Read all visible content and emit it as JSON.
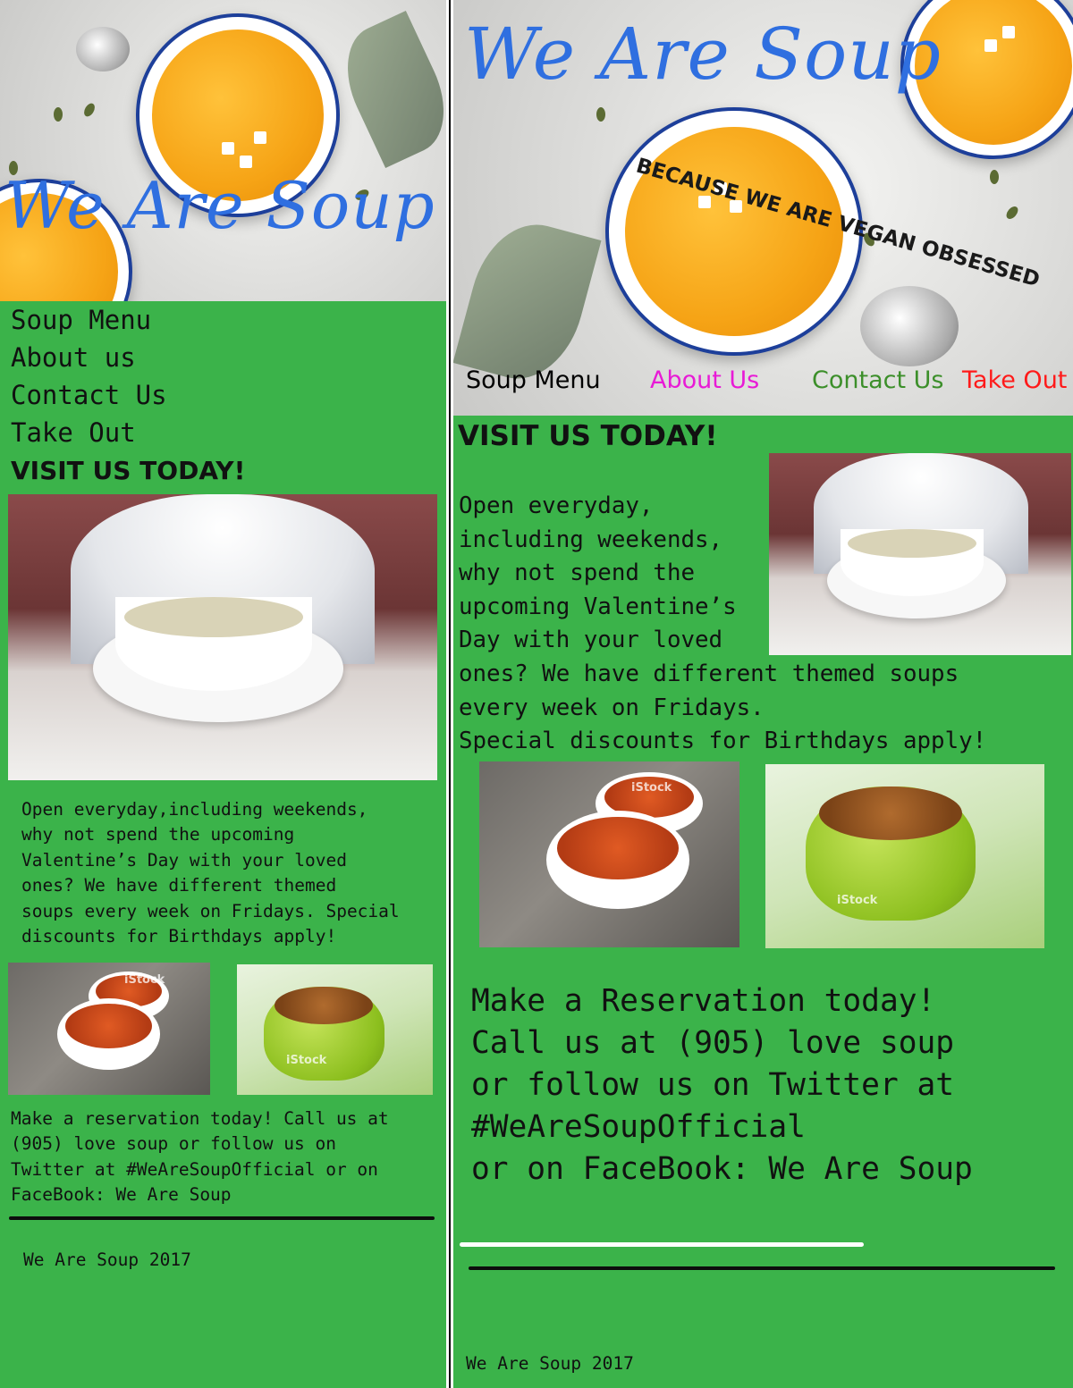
{
  "brand": {
    "name": "We Are Soup",
    "tagline": "Because we are vegan obsessed"
  },
  "nav": {
    "items": [
      "Soup Menu",
      "About us",
      "Contact Us",
      "Take Out"
    ],
    "items_wide": [
      "Soup Menu",
      "About Us",
      "Contact Us",
      "Take Out"
    ],
    "colors_wide": [
      "#000000",
      "#e81ad6",
      "#3c8f2a",
      "#ff1a1a"
    ]
  },
  "visit": {
    "heading": "Visit us today!",
    "body_mobile": "Open everyday,including weekends,\nwhy not spend the upcoming\nValentine’s Day with your loved\nones? We have different themed\nsoups every week on Fridays. Special\ndiscounts for Birthdays apply!",
    "body_wide": "Open everyday,\nincluding weekends,\nwhy not spend the\nupcoming Valentine’s\nDay with your loved\nones? We have different themed soups\nevery week on Fridays.\nSpecial discounts for Birthdays apply!"
  },
  "reservation": {
    "mobile": "Make a reservation today! Call us at\n(905) love soup or follow us on\nTwitter at #WeAreSoupOfficial or on\nFaceBook: We Are Soup",
    "wide": "Make a Reservation today!\nCall us at (905) love soup\nor follow us on Twitter at\n#WeAreSoupOfficial\nor on FaceBook: We Are Soup"
  },
  "footer": {
    "text": "We Are Soup 2017"
  },
  "watermark": "iStock",
  "colors": {
    "background": "#3bb34a",
    "brand_blue": "#2f6fe0",
    "soup_orange": "#f6a416"
  }
}
